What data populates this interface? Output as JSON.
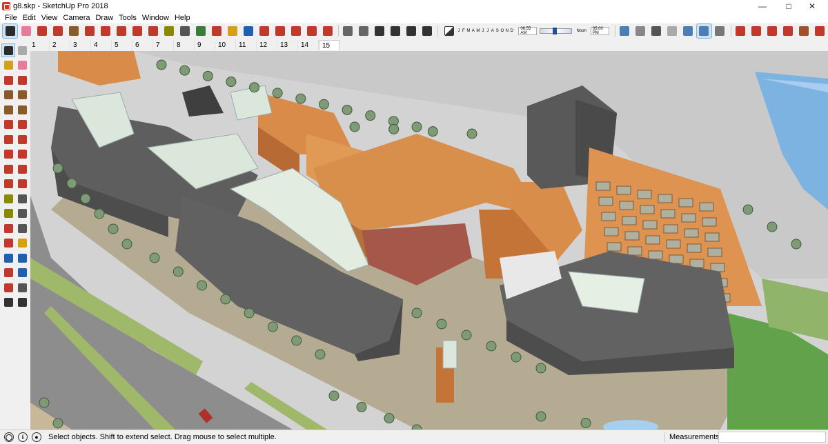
{
  "window": {
    "title": "g8.skp - SketchUp Pro 2018",
    "controls": [
      "minimize",
      "maximize",
      "close"
    ]
  },
  "menu": [
    "File",
    "Edit",
    "View",
    "Camera",
    "Draw",
    "Tools",
    "Window",
    "Help"
  ],
  "toolbar": {
    "tools": [
      {
        "name": "select-tool",
        "icon": "arrow-cursor-icon",
        "color": "#2b2b2b",
        "active": true
      },
      {
        "name": "eraser-tool",
        "icon": "eraser-icon",
        "color": "#e87a9a"
      },
      {
        "name": "line-tool",
        "icon": "pencil-icon",
        "color": "#c0392b"
      },
      {
        "name": "arc-tool",
        "icon": "arc-icon",
        "color": "#c0392b"
      },
      {
        "name": "rectangle-tool",
        "icon": "rectangle-icon",
        "color": "#8b5a2b"
      },
      {
        "name": "push-pull-tool",
        "icon": "push-pull-icon",
        "color": "#c0392b"
      },
      {
        "name": "offset-tool",
        "icon": "offset-icon",
        "color": "#c0392b"
      },
      {
        "name": "move-tool",
        "icon": "move-icon",
        "color": "#c0392b"
      },
      {
        "name": "rotate-tool",
        "icon": "rotate-icon",
        "color": "#c0392b"
      },
      {
        "name": "scale-tool",
        "icon": "scale-icon",
        "color": "#c0392b"
      },
      {
        "name": "tape-measure-tool",
        "icon": "tape-measure-icon",
        "color": "#8a8a00"
      },
      {
        "name": "text-tool",
        "icon": "text-icon",
        "color": "#555555"
      },
      {
        "name": "paint-bucket-tool",
        "icon": "paint-bucket-icon",
        "color": "#3a7d3a"
      },
      {
        "name": "orbit-tool",
        "icon": "orbit-icon",
        "color": "#c0392b"
      },
      {
        "name": "pan-tool",
        "icon": "hand-icon",
        "color": "#d4a017"
      },
      {
        "name": "zoom-tool",
        "icon": "magnifier-icon",
        "color": "#2060b0"
      },
      {
        "name": "zoom-extents-tool",
        "icon": "zoom-extents-icon",
        "color": "#c0392b"
      },
      {
        "name": "warehouse-tool",
        "icon": "warehouse-icon",
        "color": "#c0392b"
      },
      {
        "name": "extension-warehouse-tool",
        "icon": "extension-icon",
        "color": "#c0392b"
      },
      {
        "name": "send-to-layout-tool",
        "icon": "layout-icon",
        "color": "#c0392b"
      },
      {
        "name": "extension-manager-tool",
        "icon": "extension-manager-icon",
        "color": "#c0392b"
      }
    ],
    "views": [
      {
        "name": "iso-view",
        "icon": "iso-view-icon",
        "color": "#666666"
      },
      {
        "name": "top-view",
        "icon": "top-view-icon",
        "color": "#666666"
      },
      {
        "name": "front-view",
        "icon": "front-view-icon",
        "color": "#333333"
      },
      {
        "name": "right-view",
        "icon": "right-view-icon",
        "color": "#333333"
      },
      {
        "name": "back-view",
        "icon": "back-view-icon",
        "color": "#333333"
      },
      {
        "name": "left-view",
        "icon": "left-view-icon",
        "color": "#333333"
      }
    ],
    "shadow": {
      "months": [
        "J",
        "F",
        "M",
        "A",
        "M",
        "J",
        "J",
        "A",
        "S",
        "O",
        "N",
        "D"
      ],
      "start_time": "06:55 AM",
      "mid_label": "Noon",
      "end_time": "05:00 PM"
    },
    "styles": [
      {
        "name": "xray-style",
        "icon": "xray-icon",
        "color": "#4a7fb5"
      },
      {
        "name": "back-edges-style",
        "icon": "back-edges-icon",
        "color": "#888888"
      },
      {
        "name": "wireframe-style",
        "icon": "wireframe-icon",
        "color": "#555555"
      },
      {
        "name": "hidden-line-style",
        "icon": "hidden-line-icon",
        "color": "#aaaaaa"
      },
      {
        "name": "shaded-style",
        "icon": "shaded-icon",
        "color": "#4a7fb5"
      },
      {
        "name": "shaded-textures-style",
        "icon": "shaded-textures-icon",
        "color": "#4a7fb5",
        "active": true
      },
      {
        "name": "monochrome-style",
        "icon": "monochrome-icon",
        "color": "#777777"
      }
    ],
    "extras": [
      {
        "name": "walk-tool",
        "icon": "walk-icon",
        "color": "#c0392b"
      },
      {
        "name": "position-camera-tool",
        "icon": "camera-icon",
        "color": "#c0392b"
      },
      {
        "name": "look-around-tool",
        "icon": "eye-icon",
        "color": "#c0392b"
      },
      {
        "name": "section-plane-tool",
        "icon": "section-icon",
        "color": "#c0392b"
      },
      {
        "name": "component-tool",
        "icon": "component-icon",
        "color": "#a0522d"
      },
      {
        "name": "dynamic-component-tool",
        "icon": "dynamic-component-icon",
        "color": "#c0392b"
      }
    ]
  },
  "scenes": [
    "1",
    "2",
    "3",
    "4",
    "5",
    "6",
    "7",
    "8",
    "9",
    "10",
    "11",
    "12",
    "13",
    "14",
    "15"
  ],
  "active_scene": "15",
  "left_tools": [
    {
      "name": "select-tool",
      "icon": "arrow-cursor-icon",
      "color": "#2b2b2b",
      "active": true
    },
    {
      "name": "make-component-tool",
      "icon": "component-icon",
      "color": "#aaaaaa"
    },
    {
      "name": "paint-bucket-tool",
      "icon": "paint-bucket-icon",
      "color": "#d4a017"
    },
    {
      "name": "eraser-tool",
      "icon": "eraser-icon",
      "color": "#e87a9a"
    },
    {
      "name": "line-tool",
      "icon": "pencil-icon",
      "color": "#c0392b"
    },
    {
      "name": "freehand-tool",
      "icon": "freehand-icon",
      "color": "#c0392b"
    },
    {
      "name": "rectangle-tool",
      "icon": "rectangle-icon",
      "color": "#8b5a2b"
    },
    {
      "name": "rotated-rectangle-tool",
      "icon": "rotated-rectangle-icon",
      "color": "#8b5a2b"
    },
    {
      "name": "circle-tool",
      "icon": "circle-icon",
      "color": "#8b5a2b"
    },
    {
      "name": "polygon-tool",
      "icon": "polygon-icon",
      "color": "#8b5a2b"
    },
    {
      "name": "arc-tool",
      "icon": "arc-icon",
      "color": "#c0392b"
    },
    {
      "name": "two-point-arc-tool",
      "icon": "two-point-arc-icon",
      "color": "#c0392b"
    },
    {
      "name": "three-point-arc-tool",
      "icon": "three-point-arc-icon",
      "color": "#c0392b"
    },
    {
      "name": "pie-tool",
      "icon": "pie-icon",
      "color": "#c0392b"
    },
    {
      "name": "move-tool",
      "icon": "move-icon",
      "color": "#c0392b"
    },
    {
      "name": "push-pull-tool",
      "icon": "push-pull-icon",
      "color": "#c0392b"
    },
    {
      "name": "rotate-tool",
      "icon": "rotate-icon",
      "color": "#c0392b"
    },
    {
      "name": "follow-me-tool",
      "icon": "follow-me-icon",
      "color": "#c0392b"
    },
    {
      "name": "scale-tool",
      "icon": "scale-icon",
      "color": "#c0392b"
    },
    {
      "name": "offset-tool",
      "icon": "offset-icon",
      "color": "#c0392b"
    },
    {
      "name": "tape-measure-tool",
      "icon": "tape-measure-icon",
      "color": "#8a8a00"
    },
    {
      "name": "dimension-tool",
      "icon": "dimension-icon",
      "color": "#555555"
    },
    {
      "name": "protractor-tool",
      "icon": "protractor-icon",
      "color": "#8a8a00"
    },
    {
      "name": "text-tool",
      "icon": "text-icon",
      "color": "#555555"
    },
    {
      "name": "axes-tool",
      "icon": "axes-icon",
      "color": "#c0392b"
    },
    {
      "name": "3d-text-tool",
      "icon": "3d-text-icon",
      "color": "#555555"
    },
    {
      "name": "orbit-tool",
      "icon": "orbit-icon",
      "color": "#c0392b"
    },
    {
      "name": "pan-tool",
      "icon": "hand-icon",
      "color": "#d4a017"
    },
    {
      "name": "zoom-tool",
      "icon": "magnifier-icon",
      "color": "#2060b0"
    },
    {
      "name": "zoom-window-tool",
      "icon": "zoom-window-icon",
      "color": "#2060b0"
    },
    {
      "name": "zoom-extents-tool",
      "icon": "zoom-extents-icon",
      "color": "#c0392b"
    },
    {
      "name": "previous-view-tool",
      "icon": "previous-icon",
      "color": "#2060b0"
    },
    {
      "name": "position-camera-tool",
      "icon": "camera-icon",
      "color": "#c0392b"
    },
    {
      "name": "look-around-tool",
      "icon": "eye-icon",
      "color": "#555555"
    },
    {
      "name": "walk-tool",
      "icon": "walk-icon",
      "color": "#333333"
    },
    {
      "name": "section-plane-tool",
      "icon": "section-icon",
      "color": "#333333"
    }
  ],
  "status": {
    "message": "Select objects. Shift to extend select. Drag mouse to select multiple.",
    "measurements_label": "Measurements",
    "measurements_value": ""
  },
  "colors": {
    "roof_orange": "#d9904a",
    "wall_brick": "#c8743b",
    "roof_gray": "#5a5a5a",
    "glass": "#d8e8d8",
    "road": "#8c8c8c",
    "plaza": "#b0a68e",
    "courtyard": "#a85a4a",
    "grass": "#6aa84f",
    "water": "#6aa6d8"
  }
}
